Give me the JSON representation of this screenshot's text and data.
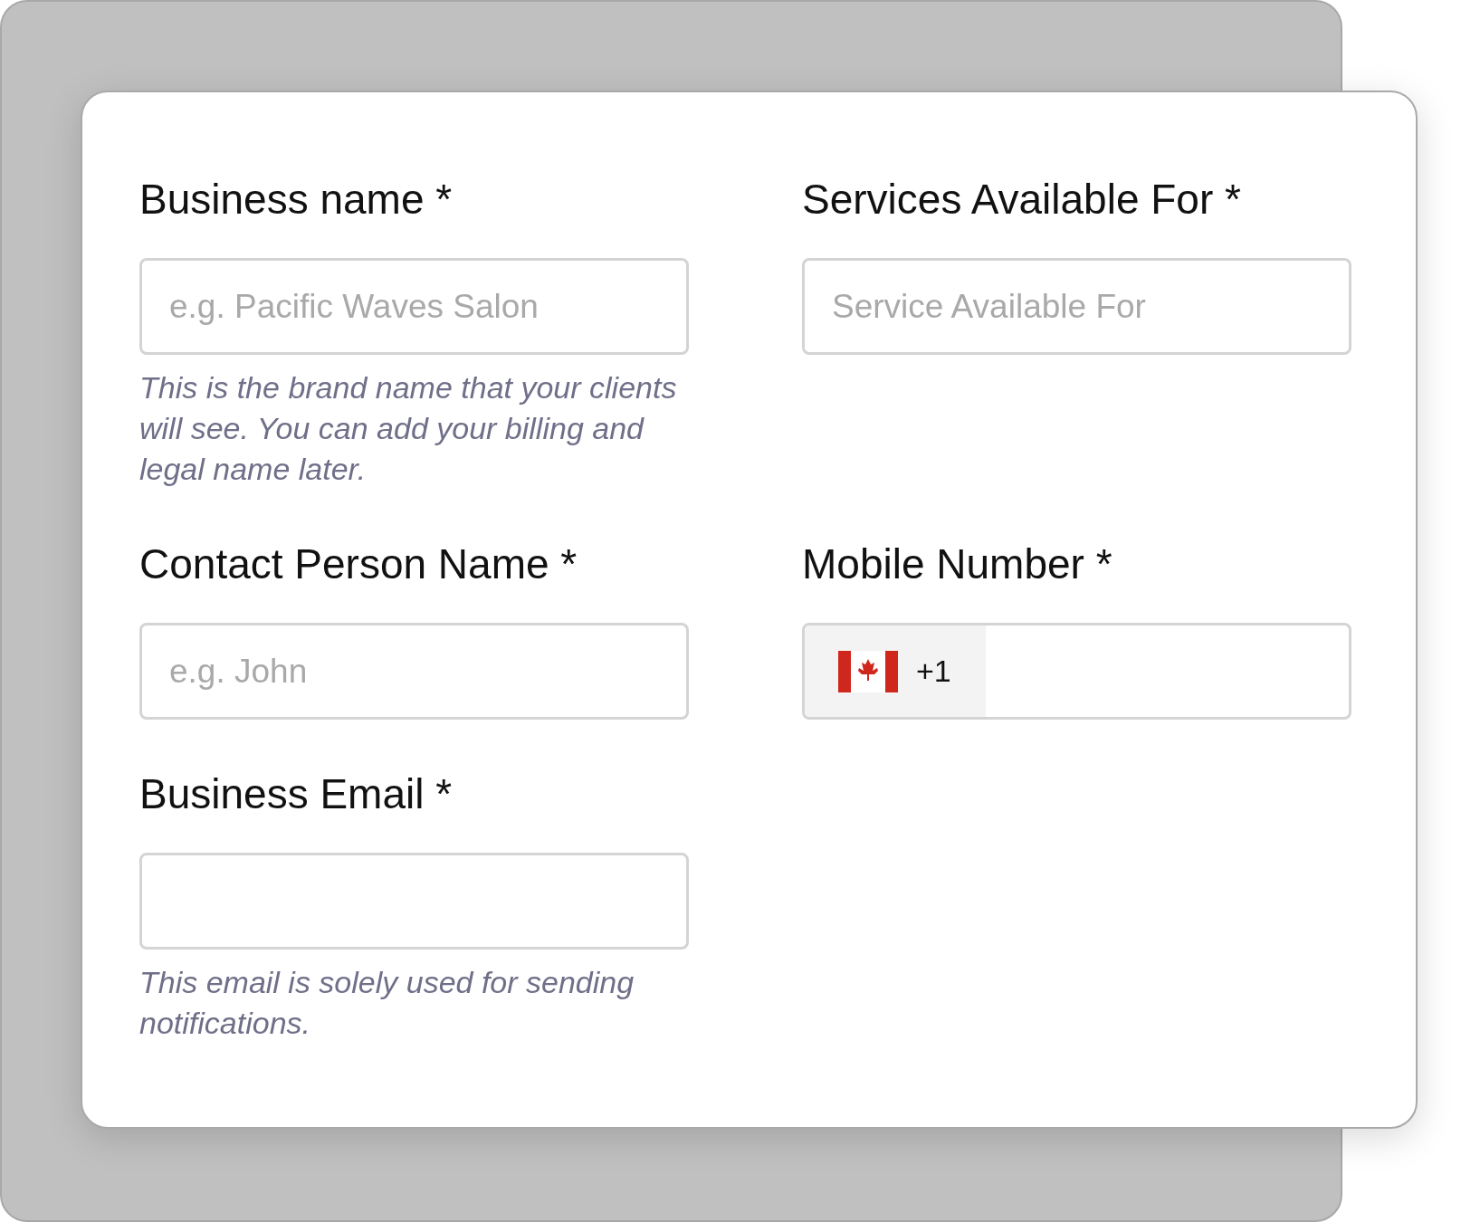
{
  "fields": [
    {
      "kind": "text",
      "label": "Business name *",
      "placeholder": "e.g. Pacific Waves Salon",
      "help": "This is the brand name that your clients will see. You can add your billing and legal name later."
    },
    {
      "kind": "text",
      "label": "Services Available For *",
      "placeholder": "Service Available For"
    },
    {
      "kind": "text",
      "label": "Contact Person Name *",
      "placeholder": "e.g. John"
    },
    {
      "kind": "phone",
      "label": "Mobile Number *",
      "country_code": "+1"
    },
    {
      "kind": "text",
      "label": "Business Email *",
      "help": "This email is solely used for sending notifications."
    }
  ]
}
